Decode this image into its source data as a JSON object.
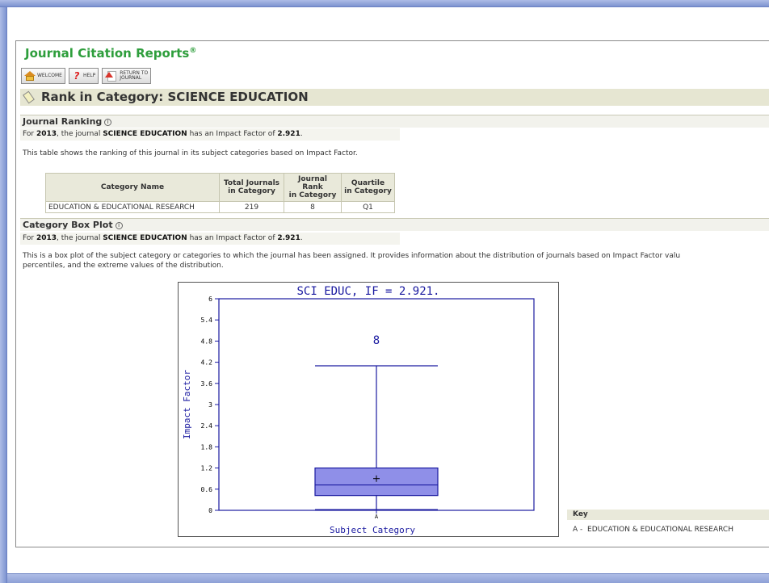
{
  "header": {
    "title": "Journal Citation Reports",
    "reg_mark": "®"
  },
  "toolbar": {
    "welcome_label": "WELCOME",
    "help_label": "HELP",
    "return_label_line1": "RETURN TO",
    "return_label_line2": "JOURNAL"
  },
  "page_title": "Rank in Category: SCIENCE EDUCATION",
  "journal_ranking": {
    "heading": "Journal Ranking",
    "info_glyph": "i",
    "for_label": "For",
    "year": "2013",
    "the_journal": ", the journal",
    "journal": "SCIENCE EDUCATION",
    "has_if": "has an Impact Factor of",
    "impact_factor": "2.921",
    "period": ".",
    "description": "This table shows the ranking of this journal in its subject categories based on Impact Factor.",
    "table": {
      "headers": [
        "Category Name",
        "Total Journals in Category",
        "Journal Rank in Category",
        "Quartile in Category"
      ],
      "header_lines": [
        [
          "Category Name"
        ],
        [
          "Total Journals",
          "in Category"
        ],
        [
          "Journal Rank",
          "in Category"
        ],
        [
          "Quartile",
          "in Category"
        ]
      ],
      "rows": [
        [
          "EDUCATION & EDUCATIONAL RESEARCH",
          "219",
          "8",
          "Q1"
        ]
      ]
    }
  },
  "box_plot_section": {
    "heading": "Category Box Plot",
    "info_glyph": "i",
    "description_line1": "This is a box plot of the subject category or categories to which the journal has been assigned. It provides information about the distribution of journals based on Impact Factor valu",
    "description_line2": "percentiles, and the extreme values of the distribution."
  },
  "chart_data": {
    "type": "box",
    "title": "SCI EDUC, IF = 2.921.",
    "xlabel": "Subject Category",
    "ylabel": "Impact Factor",
    "categories": [
      "A"
    ],
    "ylim": [
      0,
      6
    ],
    "yticks": [
      "0",
      "0.6",
      "1.2",
      "1.8",
      "2.4",
      "3",
      "3.6",
      "4.2",
      "4.8",
      "5.4",
      "6"
    ],
    "boxes": [
      {
        "category": "A",
        "min": 0.02,
        "q1": 0.42,
        "median": 0.72,
        "q3": 1.2,
        "max": 4.1,
        "mean": 0.9,
        "journal_rank_label": "8",
        "journal_value": 2.921
      }
    ],
    "colors": {
      "box_fill": "#8f8fe8",
      "lines": "#1a1aa0",
      "text": "#1a1aa0"
    }
  },
  "key": {
    "heading": "Key",
    "entries": [
      {
        "code": "A",
        "separator": " -  ",
        "name": "EDUCATION & EDUCATIONAL RESEARCH"
      }
    ]
  }
}
